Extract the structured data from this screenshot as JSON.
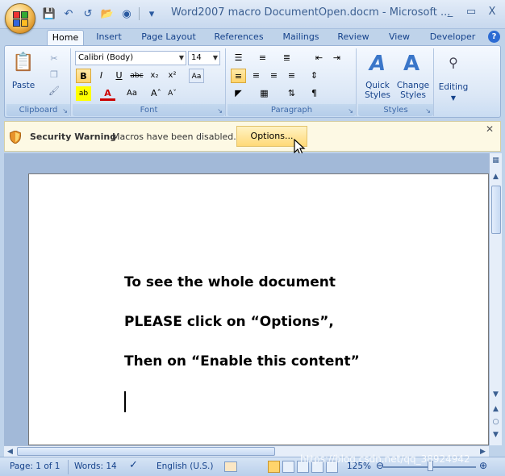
{
  "window": {
    "title": "Word2007 macro DocumentOpen.docm - Microsoft ...",
    "controls": [
      "_",
      "▭",
      "X"
    ]
  },
  "tabs": [
    "Home",
    "Insert",
    "Page Layout",
    "References",
    "Mailings",
    "Review",
    "View",
    "Developer"
  ],
  "active_tab": "Home",
  "ribbon": {
    "clipboard": {
      "label": "Clipboard",
      "paste": "Paste"
    },
    "font": {
      "label": "Font",
      "font_name": "Calibri (Body)",
      "font_size": "14"
    },
    "paragraph": {
      "label": "Paragraph"
    },
    "styles": {
      "label": "Styles",
      "quick_styles": "Quick\nStyles",
      "change_styles": "Change\nStyles"
    },
    "editing": {
      "label": "Editing"
    }
  },
  "security_bar": {
    "title": "Security Warning",
    "message": "Macros have been disabled.",
    "options_button": "Options..."
  },
  "document": {
    "lines": [
      "To see the whole document",
      "PLEASE click on “Options”,",
      "Then on “Enable this content”"
    ]
  },
  "status_bar": {
    "page": "Page: 1 of 1",
    "words": "Words: 14",
    "language": "English (U.S.)",
    "zoom": "125%"
  },
  "watermark": "https://blog.csdn.net/qq_38924942",
  "colors": {
    "accent": "#15428b",
    "ribbon_bg": "#dbe7f6",
    "security_bg": "#fdf9e4"
  }
}
